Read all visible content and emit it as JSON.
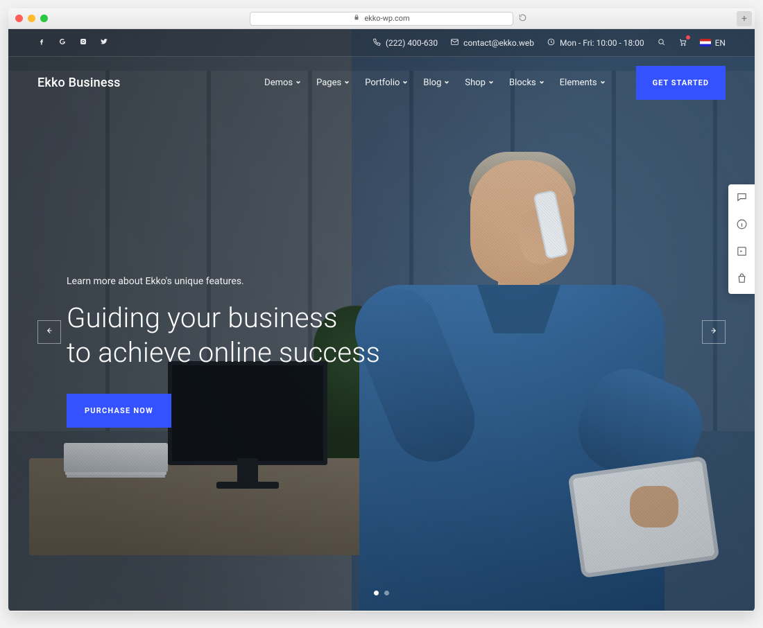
{
  "browser": {
    "url_host": "ekko-wp.com"
  },
  "topbar": {
    "phone": "(222) 400-630",
    "email": "contact@ekko.web",
    "hours": "Mon - Fri: 10:00 - 18:00",
    "language": "EN"
  },
  "nav": {
    "brand": "Ekko Business",
    "items": [
      "Demos",
      "Pages",
      "Portfolio",
      "Blog",
      "Shop",
      "Blocks",
      "Elements"
    ],
    "cta": "GET STARTED"
  },
  "hero": {
    "eyebrow": "Learn more about Ekko's unique features.",
    "headline_line1": "Guiding your business",
    "headline_line2": "to achieve online success",
    "button": "PURCHASE NOW"
  },
  "slider": {
    "total": 2,
    "active_index": 0
  },
  "colors": {
    "primary": "#3452ff"
  }
}
